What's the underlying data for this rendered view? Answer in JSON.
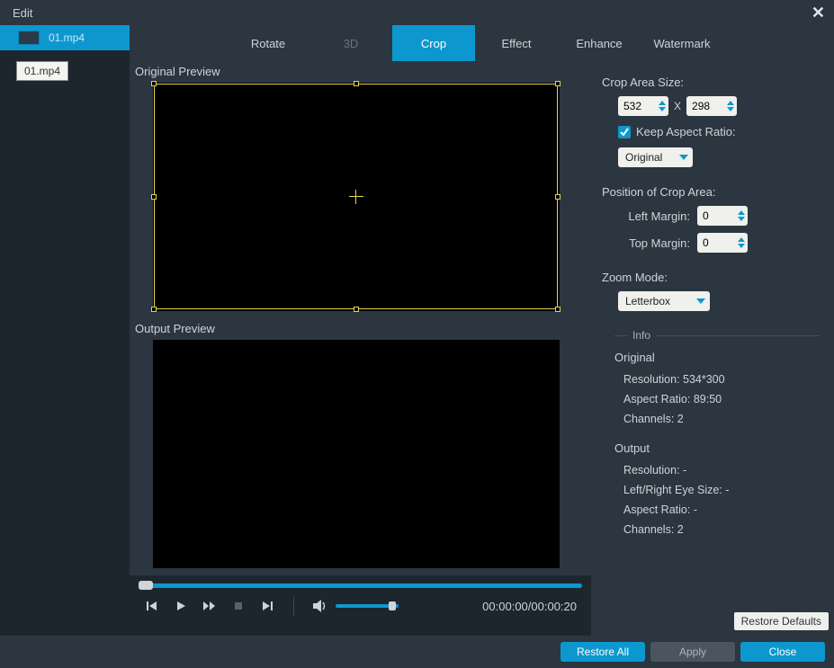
{
  "window": {
    "title": "Edit"
  },
  "sidebar": {
    "file": "01.mp4",
    "tooltip": "01.mp4"
  },
  "tabs": {
    "rotate": "Rotate",
    "threeD": "3D",
    "crop": "Crop",
    "effect": "Effect",
    "enhance": "Enhance",
    "watermark": "Watermark"
  },
  "preview": {
    "original_label": "Original Preview",
    "output_label": "Output Preview",
    "time": "00:00:00/00:00:20"
  },
  "settings": {
    "crop_size_label": "Crop Area Size:",
    "width": "532",
    "height": "298",
    "x_sep": "X",
    "keep_ar_label": "Keep Aspect Ratio:",
    "keep_ar_value": "Original",
    "position_label": "Position of Crop Area:",
    "left_margin_label": "Left Margin:",
    "left_margin": "0",
    "top_margin_label": "Top Margin:",
    "top_margin": "0",
    "zoom_label": "Zoom Mode:",
    "zoom_value": "Letterbox",
    "info_head": "Info",
    "original": {
      "title": "Original",
      "resolution": "Resolution: 534*300",
      "aspect": "Aspect Ratio: 89:50",
      "channels": "Channels: 2"
    },
    "output": {
      "title": "Output",
      "resolution": "Resolution: -",
      "eye": "Left/Right Eye Size: -",
      "aspect": "Aspect Ratio: -",
      "channels": "Channels: 2"
    },
    "restore_defaults": "Restore Defaults"
  },
  "footer": {
    "restore_all": "Restore All",
    "apply": "Apply",
    "close": "Close"
  }
}
